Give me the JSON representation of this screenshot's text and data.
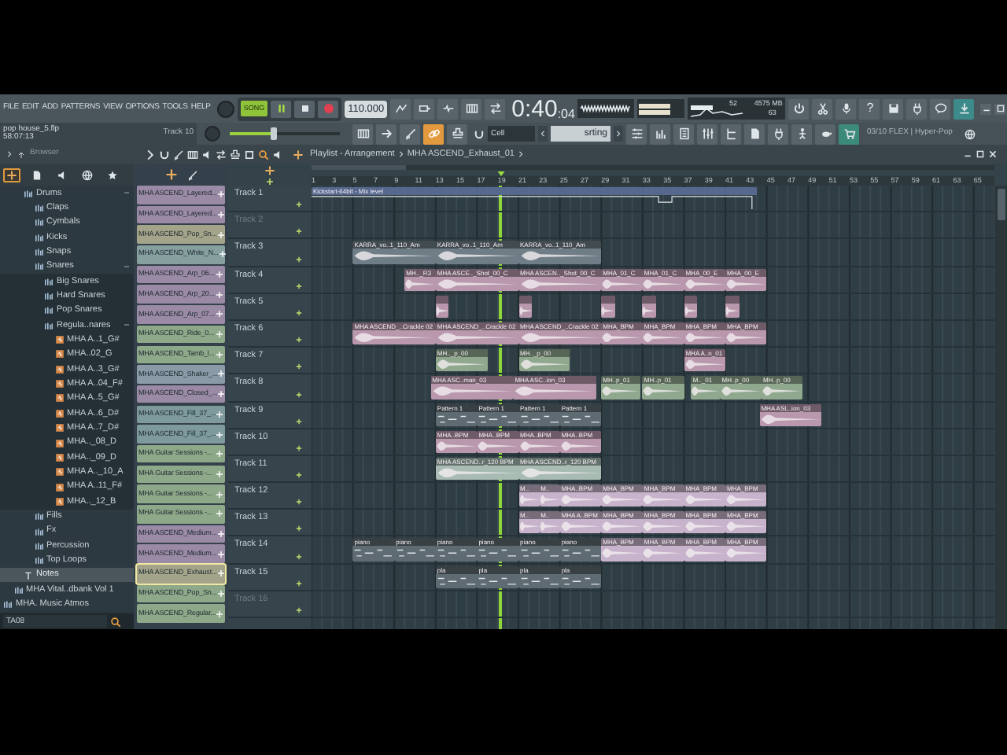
{
  "menu": [
    "FILE",
    "EDIT",
    "ADD",
    "PATTERNS",
    "VIEW",
    "OPTIONS",
    "TOOLS",
    "HELP"
  ],
  "transport": {
    "mode": {
      "label": "SONG",
      "on": true
    },
    "tempo": "110.000",
    "time": "0:40",
    "time_cs": ":04"
  },
  "monitor": {
    "polyphony": "52",
    "memory": "4575 MB",
    "cpu": "63"
  },
  "help": "?",
  "project": {
    "file": "pop house_5.flp",
    "time": "58:07:13",
    "hint": "Track 10"
  },
  "master_pitch": {
    "level": 0.4
  },
  "tools": [
    {
      "selected": false
    },
    {
      "selected": false
    },
    {
      "selected": false
    },
    {
      "selected": true
    },
    {
      "selected": false
    }
  ],
  "snap": {
    "value": "Cell"
  },
  "pattern": {
    "value": "srting"
  },
  "news": "03/10 FLEX | Hyper-Pop",
  "browser": {
    "title": "Browser",
    "tabs": [
      {
        "selected": true
      },
      {
        "selected": false
      },
      {
        "selected": false
      },
      {
        "selected": false
      },
      {
        "selected": false
      }
    ],
    "tree": [
      {
        "label": "Drums",
        "kind": "folder",
        "selected": false,
        "expanded": true,
        "children": [
          {
            "label": "Claps",
            "kind": "folder",
            "selected": false,
            "expanded": false
          },
          {
            "label": "Cymbals",
            "kind": "folder",
            "selected": false,
            "expanded": false
          },
          {
            "label": "Kicks",
            "kind": "folder",
            "selected": false,
            "expanded": false
          },
          {
            "label": "Snaps",
            "kind": "folder",
            "selected": false,
            "expanded": false
          },
          {
            "label": "Snares",
            "kind": "folder",
            "selected": false,
            "expanded": true,
            "children": [
              {
                "label": "Big Snares",
                "kind": "folder",
                "selected": false,
                "expanded": false
              },
              {
                "label": "Hard Snares",
                "kind": "folder",
                "selected": false,
                "expanded": false
              },
              {
                "label": "Pop Snares",
                "kind": "folder",
                "selected": false,
                "expanded": false
              },
              {
                "label": "Regula..nares",
                "kind": "folder",
                "selected": false,
                "expanded": true,
                "children": [
                  {
                    "label": "MHA A..1_G#",
                    "kind": "sample",
                    "selected": false
                  },
                  {
                    "label": "MHA..02_G",
                    "kind": "sample",
                    "selected": false
                  },
                  {
                    "label": "MHA A..3_G#",
                    "kind": "sample",
                    "selected": false
                  },
                  {
                    "label": "MHA A..04_F#",
                    "kind": "sample",
                    "selected": false
                  },
                  {
                    "label": "MHA A..5_G#",
                    "kind": "sample",
                    "selected": false
                  },
                  {
                    "label": "MHA A..6_D#",
                    "kind": "sample",
                    "selected": false
                  },
                  {
                    "label": "MHA A..7_D#",
                    "kind": "sample",
                    "selected": false
                  },
                  {
                    "label": "MHA.._08_D",
                    "kind": "sample",
                    "selected": false
                  },
                  {
                    "label": "MHA.._09_D",
                    "kind": "sample",
                    "selected": false
                  },
                  {
                    "label": "MHA A.._10_A",
                    "kind": "sample",
                    "selected": false
                  },
                  {
                    "label": "MHA A..11_F#",
                    "kind": "sample",
                    "selected": false
                  },
                  {
                    "label": "MHA.._12_B",
                    "kind": "sample",
                    "selected": false
                  }
                ]
              }
            ]
          },
          {
            "label": "Fills",
            "kind": "folder",
            "selected": false,
            "expanded": false
          },
          {
            "label": "Fx",
            "kind": "folder",
            "selected": false,
            "expanded": false
          },
          {
            "label": "Percussion",
            "kind": "folder",
            "selected": false,
            "expanded": false
          },
          {
            "label": "Top Loops",
            "kind": "folder",
            "selected": false,
            "expanded": false
          }
        ]
      },
      {
        "label": "Notes",
        "kind": "note",
        "selected": true
      },
      {
        "label": "MHA Vital..dbank Vol 1",
        "kind": "folder",
        "selected": false,
        "expanded": false
      },
      {
        "label": "MHA. Music Atmos",
        "kind": "folder",
        "selected": false,
        "expanded": false
      }
    ],
    "search": {
      "value": "TA08"
    }
  },
  "channels": [
    {
      "name": "MHA ASCEND_Layered...",
      "color": "#9a8aa6",
      "selected": false
    },
    {
      "name": "MHA ASCEND_Layered...",
      "color": "#9a8aa6",
      "selected": false
    },
    {
      "name": "MHA ASCEND_Pop_Sn...",
      "color": "#a4a48a",
      "selected": false
    },
    {
      "name": "MHA ASCEND_White_N...",
      "color": "#86a0a0",
      "selected": false
    },
    {
      "name": "MHA ASCEND_Arp_06...",
      "color": "#9a8aa6",
      "selected": false
    },
    {
      "name": "MHA ASCEND_Arp_20...",
      "color": "#9a8aa6",
      "selected": false
    },
    {
      "name": "MHA ASCEND_Arp_07...",
      "color": "#9a8aa6",
      "selected": false
    },
    {
      "name": "MHA ASCEND_Ride_0...",
      "color": "#8ea88a",
      "selected": false
    },
    {
      "name": "MHA ASCEND_Tamb_l...",
      "color": "#8ea88a",
      "selected": false
    },
    {
      "name": "MHA ASCEND_Shaker_...",
      "color": "#8a9aa6",
      "selected": false
    },
    {
      "name": "MHA ASCEND_Closed_...",
      "color": "#9a8aa6",
      "selected": false
    },
    {
      "name": "MHA ASCEND_Fill_37_...",
      "color": "#7e9a9c",
      "selected": false
    },
    {
      "name": "MHA ASCEND_Fill_37_...",
      "color": "#7e9a9c",
      "selected": false
    },
    {
      "name": "MHA Guitar Sessions -...",
      "color": "#8ea88a",
      "selected": false
    },
    {
      "name": "MHA Guitar Sessions -...",
      "color": "#8ea88a",
      "selected": false
    },
    {
      "name": "MHA Guitar Sessions -...",
      "color": "#8ea88a",
      "selected": false
    },
    {
      "name": "MHA Guitar Sessions -...",
      "color": "#8ea88a",
      "selected": false
    },
    {
      "name": "MHA ASCEND_Medium...",
      "color": "#9a8aa6",
      "selected": false
    },
    {
      "name": "MHA ASCEND_Medium...",
      "color": "#9a8aa6",
      "selected": false
    },
    {
      "name": "MHA ASCEND_Exhaust...",
      "color": "#a4a48a",
      "selected": true
    },
    {
      "name": "MHA ASCEND_Pop_Sn...",
      "color": "#8ea88a",
      "selected": false
    },
    {
      "name": "MHA ASCEND_Regular...",
      "color": "#8ea88a",
      "selected": false
    }
  ],
  "playlist": {
    "title": "Playlist - Arrangement",
    "pattern": "MHA ASCEND_Exhaust_01",
    "ruler": [
      "1",
      "3",
      "5",
      "7",
      "9",
      "11",
      "13",
      "15",
      "17",
      "19",
      "21",
      "23",
      "25",
      "27",
      "29",
      "31",
      "33",
      "35",
      "37",
      "39",
      "41",
      "43",
      "45",
      "47",
      "49",
      "51",
      "53",
      "55",
      "57",
      "59",
      "61",
      "63",
      "65"
    ],
    "playhead": {
      "level": 0.277
    },
    "tracks": [
      {
        "name": "Track 1",
        "muted": false,
        "clips": [
          {
            "label": "Kickstart-64bit - Mix level",
            "kind": "automation",
            "color": "#56688e"
          }
        ]
      },
      {
        "name": "Track 2",
        "muted": true
      },
      {
        "name": "Track 3",
        "muted": false,
        "clips": [
          {
            "label": "KARRA_vo..1_110_Am",
            "kind": "audio",
            "color": "#6f7e86"
          },
          {
            "label": "KARRA_vo..1_110_Am",
            "kind": "audio",
            "color": "#6f7e86"
          },
          {
            "label": "KARRA_vo..1_110_Am",
            "kind": "audio",
            "color": "#6f7e86"
          }
        ]
      },
      {
        "name": "Track 4",
        "muted": false,
        "clips": [
          {
            "label": "MH.._R3",
            "kind": "audio",
            "color": "#b998ad"
          },
          {
            "label": "MHA ASCE.._Shot_00_C",
            "kind": "audio",
            "color": "#b998ad"
          },
          {
            "label": "MHA ASCEN.._Shot_00_C",
            "kind": "audio",
            "color": "#b998ad"
          },
          {
            "label": "MHA_01_C",
            "kind": "audio",
            "color": "#b998ad"
          },
          {
            "label": "MHA_01_C",
            "kind": "audio",
            "color": "#b998ad"
          },
          {
            "label": "MHA_00_E",
            "kind": "audio",
            "color": "#b998ad"
          },
          {
            "label": "MHA_00_E",
            "kind": "audio",
            "color": "#b998ad"
          }
        ]
      },
      {
        "name": "Track 5",
        "muted": false,
        "clips": [
          {
            "kind": "audio",
            "color": "#b998ad"
          },
          {
            "kind": "audio",
            "color": "#b998ad"
          },
          {
            "kind": "audio",
            "color": "#b998ad"
          },
          {
            "kind": "audio",
            "color": "#b998ad"
          },
          {
            "kind": "audio",
            "color": "#b998ad"
          },
          {
            "kind": "audio",
            "color": "#b998ad"
          }
        ]
      },
      {
        "name": "Track 6",
        "muted": false,
        "clips": [
          {
            "label": "MHA ASCEND_..Crackle 02",
            "kind": "audio",
            "color": "#b998ad"
          },
          {
            "label": "MHA ASCEND_..Crackle 02",
            "kind": "audio",
            "color": "#b998ad"
          },
          {
            "label": "MHA ASCEND_..Crackle 02",
            "kind": "audio",
            "color": "#b998ad"
          },
          {
            "label": "MHA_BPM",
            "kind": "audio",
            "color": "#b998ad"
          },
          {
            "label": "MHA_BPM",
            "kind": "audio",
            "color": "#b998ad"
          },
          {
            "label": "MHA_BPM",
            "kind": "audio",
            "color": "#b998ad"
          },
          {
            "label": "MHA_BPM",
            "kind": "audio",
            "color": "#b998ad"
          }
        ]
      },
      {
        "name": "Track 7",
        "muted": false,
        "clips": [
          {
            "label": "MH.._p_00",
            "kind": "audio",
            "color": "#8fa88e"
          },
          {
            "label": "MH.._p_00",
            "kind": "audio",
            "color": "#8fa88e"
          },
          {
            "label": "MHA A..n_01",
            "kind": "audio",
            "color": "#b998ad"
          }
        ]
      },
      {
        "name": "Track 8",
        "muted": false,
        "clips": [
          {
            "label": "MHA ASC..man_03",
            "kind": "audio",
            "color": "#b998ad"
          },
          {
            "label": "MHA ASC..ion_03",
            "kind": "audio",
            "color": "#b998ad"
          },
          {
            "label": "MH..p_01",
            "kind": "audio",
            "color": "#8fa88e"
          },
          {
            "label": "MH..p_01",
            "kind": "audio",
            "color": "#8fa88e"
          },
          {
            "label": "M.._01",
            "kind": "audio",
            "color": "#8fa88e"
          },
          {
            "label": "MH..p_00",
            "kind": "audio",
            "color": "#8fa88e"
          },
          {
            "label": "MH..p_00",
            "kind": "audio",
            "color": "#8fa88e"
          }
        ]
      },
      {
        "name": "Track 9",
        "muted": false,
        "clips": [
          {
            "label": "Pattern 1",
            "kind": "pattern",
            "color": "#5e6b72"
          },
          {
            "label": "Pattern 1",
            "kind": "pattern",
            "color": "#5e6b72"
          },
          {
            "label": "Pattern 1",
            "kind": "pattern",
            "color": "#5e6b72"
          },
          {
            "label": "Pattern 1",
            "kind": "pattern",
            "color": "#5e6b72"
          },
          {
            "label": "MHA ASL..ion_03",
            "kind": "audio",
            "color": "#b998ad"
          }
        ]
      },
      {
        "name": "Track 10",
        "muted": false,
        "clips": [
          {
            "label": "MHA..BPM",
            "kind": "audio",
            "color": "#b998ad"
          },
          {
            "label": "MHA..BPM",
            "kind": "audio",
            "color": "#b998ad"
          },
          {
            "label": "MHA..BPM",
            "kind": "audio",
            "color": "#b998ad"
          },
          {
            "label": "MHA..BPM",
            "kind": "audio",
            "color": "#b998ad"
          }
        ]
      },
      {
        "name": "Track 11",
        "muted": false,
        "clips": [
          {
            "label": "MHA ASCEND..r_120 BPM",
            "kind": "audio",
            "color": "#a9bcb4"
          },
          {
            "label": "MHA ASCEND..r_120 BPM",
            "kind": "audio",
            "color": "#a9bcb4"
          }
        ]
      },
      {
        "name": "Track 12",
        "muted": false,
        "clips": [
          {
            "label": "M..",
            "kind": "audio",
            "color": "#c8b3cc"
          },
          {
            "label": "M..",
            "kind": "audio",
            "color": "#c8b3cc"
          },
          {
            "label": "MHA..BPM",
            "kind": "audio",
            "color": "#c8b3cc"
          },
          {
            "label": "MHA_BPM",
            "kind": "audio",
            "color": "#c8b3cc"
          },
          {
            "label": "MHA_BPM",
            "kind": "audio",
            "color": "#c8b3cc"
          },
          {
            "label": "MHA_BPM",
            "kind": "audio",
            "color": "#c8b3cc"
          },
          {
            "label": "MHA_BPM",
            "kind": "audio",
            "color": "#c8b3cc"
          }
        ]
      },
      {
        "name": "Track 13",
        "muted": false,
        "clips": [
          {
            "label": "M..",
            "kind": "audio",
            "color": "#c8b3cc"
          },
          {
            "label": "M..",
            "kind": "audio",
            "color": "#c8b3cc"
          },
          {
            "label": "MHA A..BPM",
            "kind": "audio",
            "color": "#c8b3cc"
          },
          {
            "label": "MHA_BPM",
            "kind": "audio",
            "color": "#c8b3cc"
          },
          {
            "label": "MHA_BPM",
            "kind": "audio",
            "color": "#c8b3cc"
          },
          {
            "label": "MHA_BPM",
            "kind": "audio",
            "color": "#c8b3cc"
          },
          {
            "label": "MHA_BPM",
            "kind": "audio",
            "color": "#c8b3cc"
          }
        ]
      },
      {
        "name": "Track 14",
        "muted": false,
        "clips": [
          {
            "label": "piano",
            "kind": "pattern",
            "color": "#5e6b72"
          },
          {
            "label": "piano",
            "kind": "pattern",
            "color": "#5e6b72"
          },
          {
            "label": "piano",
            "kind": "pattern",
            "color": "#5e6b72"
          },
          {
            "label": "piano",
            "kind": "pattern",
            "color": "#5e6b72"
          },
          {
            "label": "piano",
            "kind": "pattern",
            "color": "#5e6b72"
          },
          {
            "label": "piano",
            "kind": "pattern",
            "color": "#5e6b72"
          },
          {
            "label": "MHA_BPM",
            "kind": "audio",
            "color": "#c8b3cc"
          },
          {
            "label": "MHA_BPM",
            "kind": "audio",
            "color": "#c8b3cc"
          },
          {
            "label": "MHA_BPM",
            "kind": "audio",
            "color": "#c8b3cc"
          },
          {
            "label": "MHA_BPM",
            "kind": "audio",
            "color": "#c8b3cc"
          }
        ]
      },
      {
        "name": "Track 15",
        "muted": false,
        "clips": [
          {
            "label": "pla",
            "kind": "pattern",
            "color": "#5e6b72"
          },
          {
            "label": "pla",
            "kind": "pattern",
            "color": "#5e6b72"
          },
          {
            "label": "pla",
            "kind": "pattern",
            "color": "#5e6b72"
          },
          {
            "label": "pla",
            "kind": "pattern",
            "color": "#5e6b72"
          }
        ]
      },
      {
        "name": "Track 16",
        "muted": true
      }
    ]
  }
}
